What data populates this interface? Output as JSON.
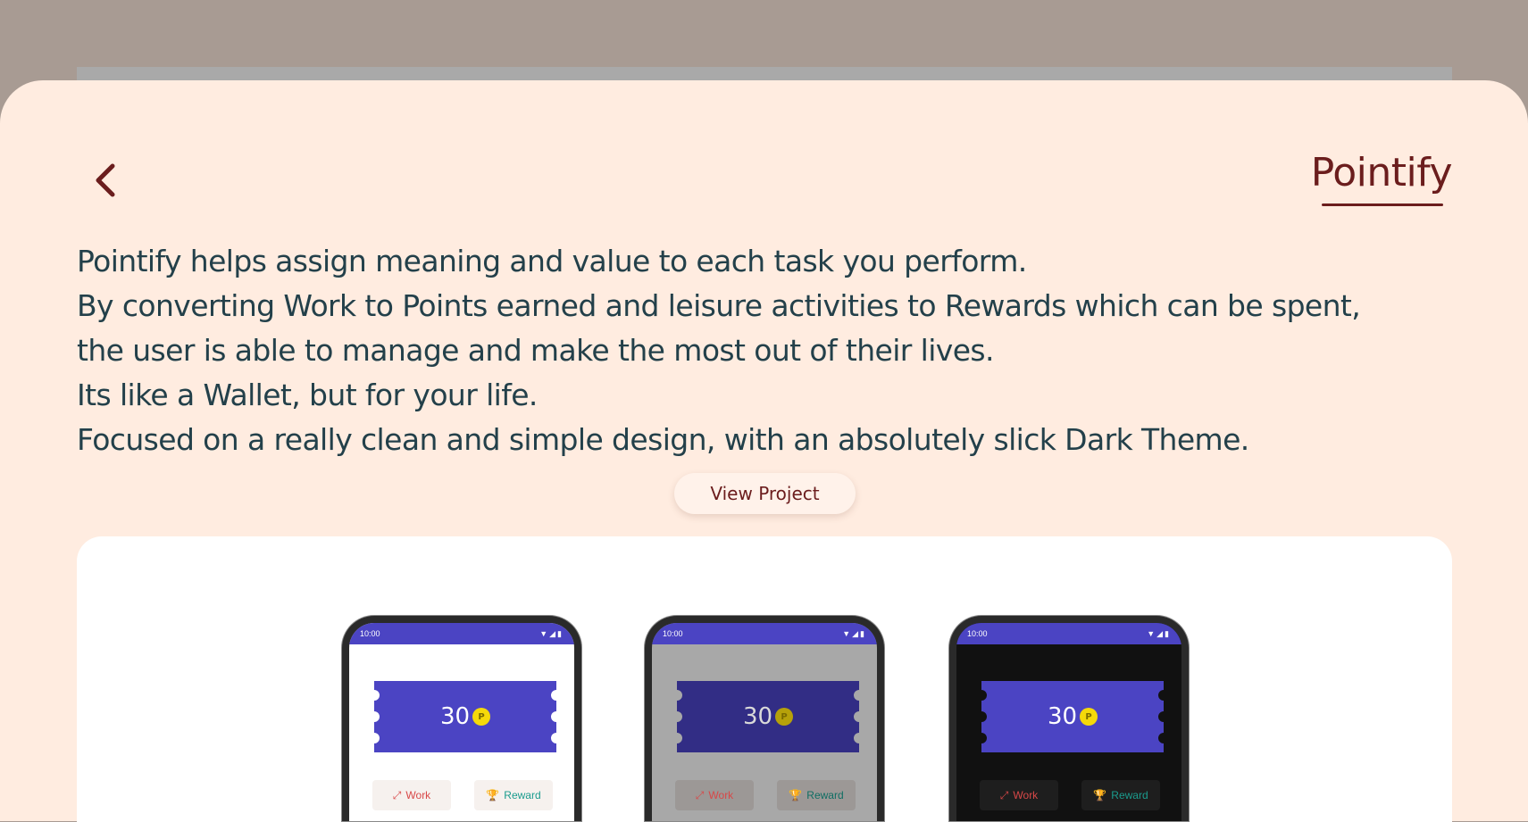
{
  "header": {
    "title": "Pointify",
    "back_icon": "chevron-left-icon"
  },
  "description": {
    "lines": [
      "Pointify helps assign meaning and value to each task you perform.",
      "By converting Work to Points earned and leisure activities to Rewards which can be spent,",
      "the user is able to manage and make the most out of their lives.",
      "Its like a Wallet, but for your life.",
      "Focused on a really clean and simple design, with an absolutely slick Dark Theme."
    ]
  },
  "actions": {
    "view_project_label": "View Project"
  },
  "screenshots": [
    {
      "theme": "light",
      "time": "10:00",
      "points": "30",
      "coin_symbol": "P",
      "work_label": "Work",
      "reward_label": "Reward"
    },
    {
      "theme": "dimmed",
      "time": "10:00",
      "points": "30",
      "coin_symbol": "P",
      "work_label": "Work",
      "reward_label": "Reward"
    },
    {
      "theme": "dark",
      "time": "10:00",
      "points": "30",
      "coin_symbol": "P",
      "work_label": "Work",
      "reward_label": "Reward"
    }
  ],
  "colors": {
    "background": "#a89b93",
    "sheet": "#ffece0",
    "accent": "#6b1d1d",
    "text": "#23404a",
    "ticket": "#4b44c3",
    "coin": "#f5d90a",
    "work": "#d84848",
    "reward": "#1a9c8e"
  }
}
